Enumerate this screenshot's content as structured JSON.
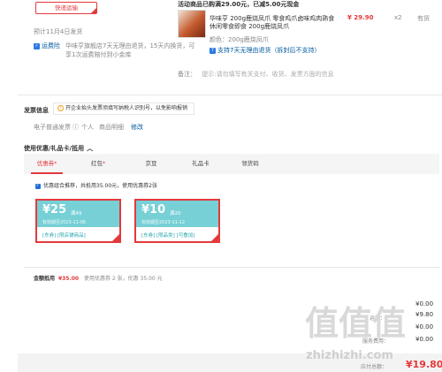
{
  "shipping": {
    "button": "快递运输",
    "estimate": "预计11月4日发货",
    "returns_tag": "运费险",
    "returns_desc_1": "华味亨旗舰店7天无理由退货，15天内换货，可",
    "returns_desc_2": "享1次运费赔付到小金库"
  },
  "promo": {
    "banner": "活动商品已购满29.00元，已减5.00元现金"
  },
  "product": {
    "name_1": "华味亨 200g鹿烧凤爪 零食鸡爪卤味鸡肉熟食",
    "name_2": "休闲零食即食 200g鹿烧凤爪",
    "price": "¥ 29.90",
    "qty": "x2",
    "stock": "有货",
    "color_label": "颜色：200g鹿烧凤爪",
    "support_returns": "支持7天无理由退货（拆封后不支持）"
  },
  "remark": {
    "label": "备注：",
    "placeholder": "提示:请勿填写有关支付、收货、发票方面的信息"
  },
  "invoice": {
    "title": "发票信息",
    "tip": "开企业抬头发票须填写纳税人识别号，以免影响报销",
    "type": "电子普通发票",
    "person": "个人",
    "detail": "商品明细",
    "edit": "修改"
  },
  "discount": {
    "title": "使用优惠/礼品卡/抵用",
    "tabs": [
      "优惠券",
      "红包",
      "京豆",
      "礼品卡",
      "领货码"
    ],
    "tab_stars": [
      "*",
      "*",
      "",
      "",
      ""
    ],
    "checkbox_text": "优惠组合推荐，共抵用35.00元，使用优惠券2张",
    "coupons": [
      {
        "amount": "¥25",
        "cond": "满49",
        "date": "有效期至2023-11-06",
        "tags": "[东券] [限店铺商品]"
      },
      {
        "amount": "¥10",
        "cond": "满20",
        "date": "有效期至2023-11-12",
        "tags": "[东券] [限品类] [可叠加]"
      }
    ],
    "summary_label": "金额抵用",
    "summary_amount": "¥35.00",
    "summary_detail": "使用优惠券 2 张，优惠 35.00 元"
  },
  "totals": {
    "row_values": [
      "¥0.00",
      "¥9.80",
      "¥0.00",
      "¥0.00"
    ],
    "row_labels": [
      "",
      "运费：",
      "",
      "服务费用："
    ],
    "payable_label": "应付总额：",
    "payable_amount": "¥19.80"
  },
  "watermark": {
    "url": "zhizhizhi.com",
    "chars": "值值值"
  }
}
